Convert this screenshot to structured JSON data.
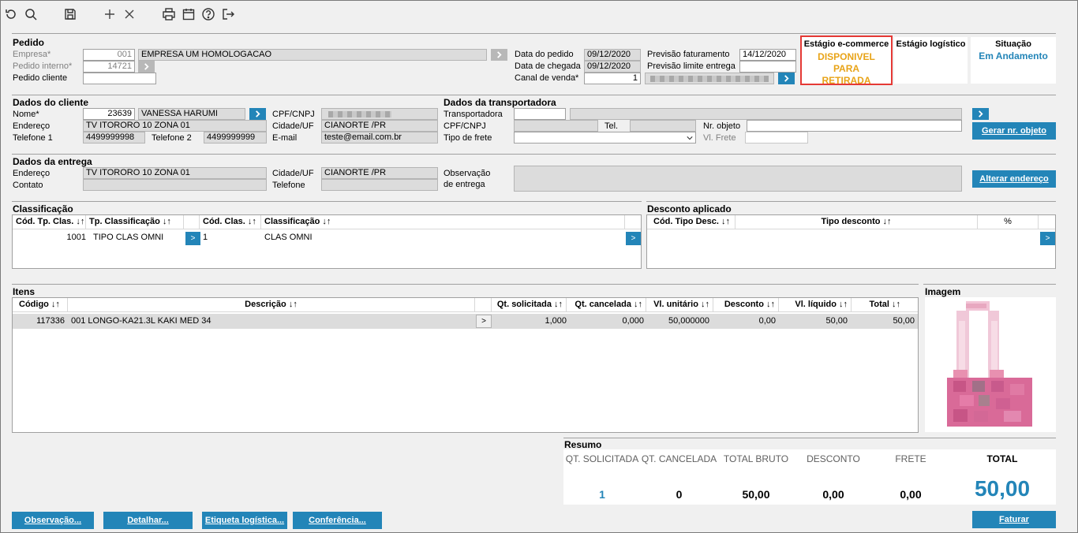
{
  "toolbar": {
    "icons": [
      "undo-icon",
      "search-icon",
      "save-icon",
      "add-icon",
      "close-icon",
      "print-icon",
      "calendar-icon",
      "help-icon",
      "exit-icon"
    ]
  },
  "pedido": {
    "title": "Pedido",
    "empresa_label": "Empresa*",
    "empresa_code": "001",
    "empresa_name": "EMPRESA UM HOMOLOGACAO",
    "pedido_interno_label": "Pedido interno*",
    "pedido_interno": "14721",
    "pedido_cliente_label": "Pedido cliente",
    "pedido_cliente": "",
    "data_pedido_label": "Data do pedido",
    "data_pedido": "09/12/2020",
    "data_chegada_label": "Data de chegada",
    "data_chegada": "09/12/2020",
    "canal_venda_label": "Canal de venda*",
    "canal_venda": "1",
    "previsao_faturamento_label": "Previsão faturamento",
    "previsao_faturamento": "14/12/2020",
    "previsao_limite_label": "Previsão limite entrega",
    "previsao_limite": ""
  },
  "status_cards": {
    "ecommerce_title": "Estágio e-commerce",
    "ecommerce_value": "DISPONIVEL PARA RETIRADA",
    "ecommerce_color": "#e8a317",
    "logistico_title": "Estágio logístico",
    "logistico_value": "",
    "situacao_title": "Situação",
    "situacao_value": "Em Andamento",
    "situacao_color": "#2385b8"
  },
  "cliente": {
    "title": "Dados do cliente",
    "nome_label": "Nome*",
    "nome_code": "23639",
    "nome": "VANESSA HARUMI",
    "endereco_label": "Endereço",
    "endereco": "TV ITORORO 10  ZONA 01",
    "telefone1_label": "Telefone 1",
    "telefone1": "4499999998",
    "telefone2_label": "Telefone 2",
    "telefone2": "4499999999",
    "cpf_label": "CPF/CNPJ",
    "cidade_label": "Cidade/UF",
    "cidade": "CIANORTE /PR",
    "email_label": "E-mail",
    "email": "teste@email.com.br"
  },
  "transportadora": {
    "title": "Dados da transportadora",
    "transportadora_label": "Transportadora",
    "cpf_label": "CPF/CNPJ",
    "tel_label": "Tel.",
    "tipo_frete_label": "Tipo de frete",
    "nr_objeto_label": "Nr. objeto",
    "vl_frete_label": "Vl. Frete",
    "gerar_button": "Gerar nr. objeto"
  },
  "entrega": {
    "title": "Dados da entrega",
    "endereco_label": "Endereço",
    "endereco": "TV ITORORO 10  ZONA 01",
    "contato_label": "Contato",
    "cidade_label": "Cidade/UF",
    "cidade": "CIANORTE /PR",
    "telefone_label": "Telefone",
    "observacao_label1": "Observação",
    "observacao_label2": "de entrega",
    "alterar_button": "Alterar endereço"
  },
  "classificacao": {
    "title": "Classificação",
    "headers": [
      "Cód. Tp. Clas. ↓↑",
      "Tp. Classificação ↓↑",
      "Cód. Clas. ↓↑",
      "Classificação ↓↑"
    ],
    "row": {
      "cod_tp": "1001",
      "tp": "TIPO CLAS OMNI",
      "cod": "1",
      "clas": "CLAS OMNI"
    }
  },
  "desconto": {
    "title": "Desconto aplicado",
    "headers": [
      "Cód. Tipo Desc. ↓↑",
      "Tipo desconto ↓↑",
      "%"
    ]
  },
  "itens": {
    "title": "Itens",
    "headers": [
      "Código ↓↑",
      "Descrição ↓↑",
      "Qt. solicitada ↓↑",
      "Qt. cancelada ↓↑",
      "Vl. unitário ↓↑",
      "Desconto ↓↑",
      "Vl. líquido ↓↑",
      "Total ↓↑"
    ],
    "row": {
      "codigo": "117336",
      "descricao": "001 LONGO-KA21.3L KAKI MED 34",
      "qt_sol": "1,000",
      "qt_can": "0,000",
      "vl_unit": "50,000000",
      "desconto": "0,00",
      "vl_liq": "50,00",
      "total": "50,00"
    }
  },
  "imagem": {
    "title": "Imagem"
  },
  "resumo": {
    "title": "Resumo",
    "qt_sol_label": "QT. SOLICITADA",
    "qt_can_label": "QT. CANCELADA",
    "total_bruto_label": "TOTAL BRUTO",
    "desconto_label": "DESCONTO",
    "frete_label": "FRETE",
    "total_label": "TOTAL",
    "qt_sol": "1",
    "qt_can": "0",
    "total_bruto": "50,00",
    "desconto": "0,00",
    "frete": "0,00",
    "total": "50,00",
    "accent": "#2385b8"
  },
  "buttons": {
    "observacao": "Observação...",
    "detalhar": "Detalhar...",
    "etiqueta": "Etiqueta logística...",
    "conferencia": "Conferência...",
    "faturar": "Faturar"
  }
}
